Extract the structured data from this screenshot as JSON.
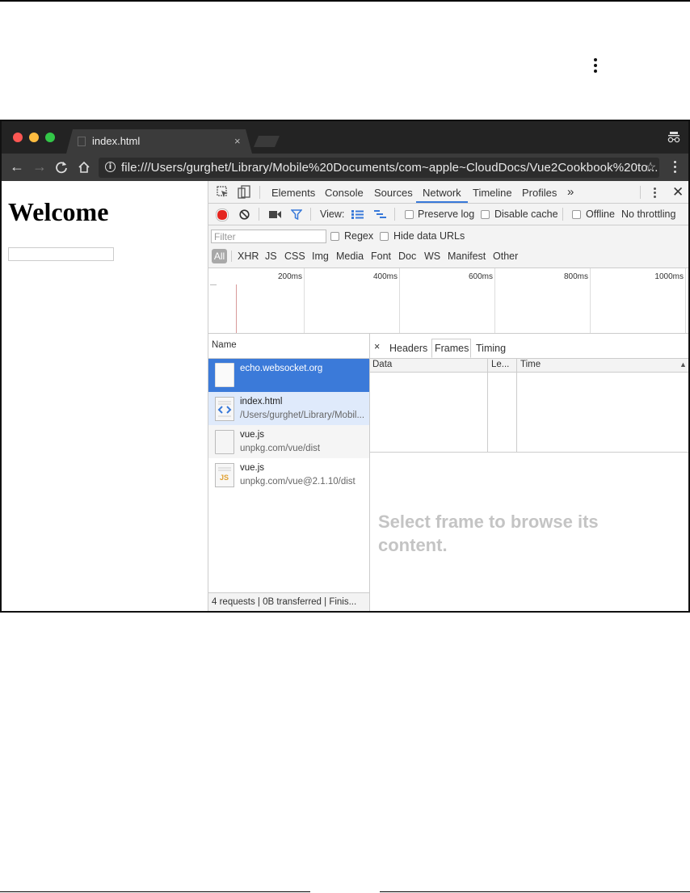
{
  "browser": {
    "tab_title": "index.html",
    "tab_close": "×",
    "url": "file:///Users/gurghet/Library/Mobile%20Documents/com~apple~CloudDocs/Vue2Cookbook%20to...",
    "nav_icons": [
      "back-icon",
      "forward-icon",
      "reload-icon",
      "home-icon"
    ]
  },
  "page": {
    "heading": "Welcome",
    "input_value": ""
  },
  "devtools": {
    "panel_tabs": [
      "Elements",
      "Console",
      "Sources",
      "Network",
      "Timeline",
      "Profiles",
      "»"
    ],
    "active_tab": "Network",
    "toolbar": {
      "view_label": "View:",
      "preserve_log": "Preserve log",
      "disable_cache": "Disable cache",
      "offline": "Offline",
      "throttling": "No throttling"
    },
    "filter": {
      "placeholder": "Filter",
      "regex": "Regex",
      "hide_data_urls": "Hide data URLs"
    },
    "types": [
      "All",
      "XHR",
      "JS",
      "CSS",
      "Img",
      "Media",
      "Font",
      "Doc",
      "WS",
      "Manifest",
      "Other"
    ],
    "overview_ticks": [
      "200ms",
      "400ms",
      "600ms",
      "800ms",
      "1000ms"
    ],
    "list": {
      "column_name": "Name",
      "rows": [
        {
          "name": "echo.websocket.org",
          "path": "",
          "selected": true
        },
        {
          "name": "index.html",
          "path": "/Users/gurghet/Library/Mobil...",
          "selected": false
        },
        {
          "name": "vue.js",
          "path": "unpkg.com/vue/dist",
          "selected": false
        },
        {
          "name": "vue.js",
          "path": "unpkg.com/vue@2.1.10/dist",
          "selected": false
        }
      ],
      "status": "4 requests | 0B transferred | Finis..."
    },
    "detail": {
      "close": "×",
      "tabs": [
        "Headers",
        "Frames",
        "Timing"
      ],
      "active_tab": "Frames",
      "columns": [
        "Data",
        "Le...",
        "Time"
      ],
      "sort_indicator": "▲",
      "placeholder": "Select frame to browse its content."
    }
  },
  "colors": {
    "accent": "#3879d9",
    "selected_row": "#3b7ad9",
    "record": "#e4251f"
  }
}
